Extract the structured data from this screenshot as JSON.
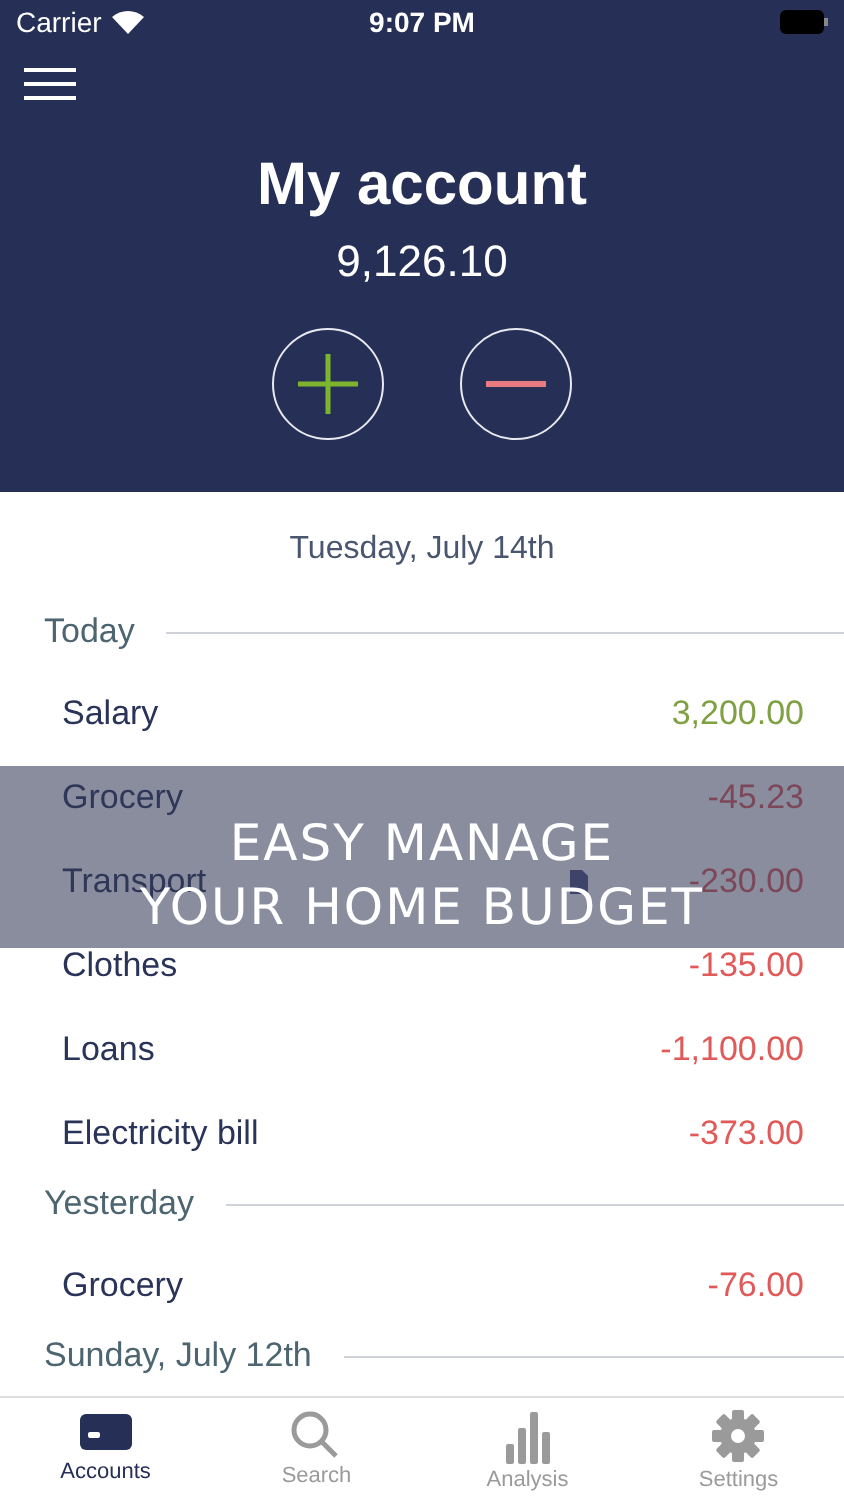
{
  "status_bar": {
    "carrier": "Carrier",
    "time": "9:07 PM"
  },
  "account": {
    "title": "My account",
    "balance": "9,126.10"
  },
  "date_heading": "Tuesday, July 14th",
  "sections": [
    {
      "label": "Today",
      "rows": [
        {
          "name": "Salary",
          "amount": "3,200.00",
          "kind": "income",
          "note": false
        },
        {
          "name": "Grocery",
          "amount": "-45.23",
          "kind": "expense",
          "note": false
        },
        {
          "name": "Transport",
          "amount": "-230.00",
          "kind": "expense",
          "note": true
        },
        {
          "name": "Clothes",
          "amount": "-135.00",
          "kind": "expense",
          "note": false
        },
        {
          "name": "Loans",
          "amount": "-1,100.00",
          "kind": "expense",
          "note": false
        },
        {
          "name": "Electricity bill",
          "amount": "-373.00",
          "kind": "expense",
          "note": false
        }
      ]
    },
    {
      "label": "Yesterday",
      "rows": [
        {
          "name": "Grocery",
          "amount": "-76.00",
          "kind": "expense",
          "note": false
        }
      ]
    },
    {
      "label": "Sunday, July 12th"
    }
  ],
  "banner": [
    "EASY MANAGE",
    "YOUR HOME BUDGET"
  ],
  "tabs": [
    {
      "label": "Accounts",
      "kind": "card",
      "selected": true
    },
    {
      "label": "Search",
      "kind": "search",
      "selected": false
    },
    {
      "label": "Analysis",
      "kind": "chart",
      "selected": false
    },
    {
      "label": "Settings",
      "kind": "gear",
      "selected": false
    }
  ]
}
